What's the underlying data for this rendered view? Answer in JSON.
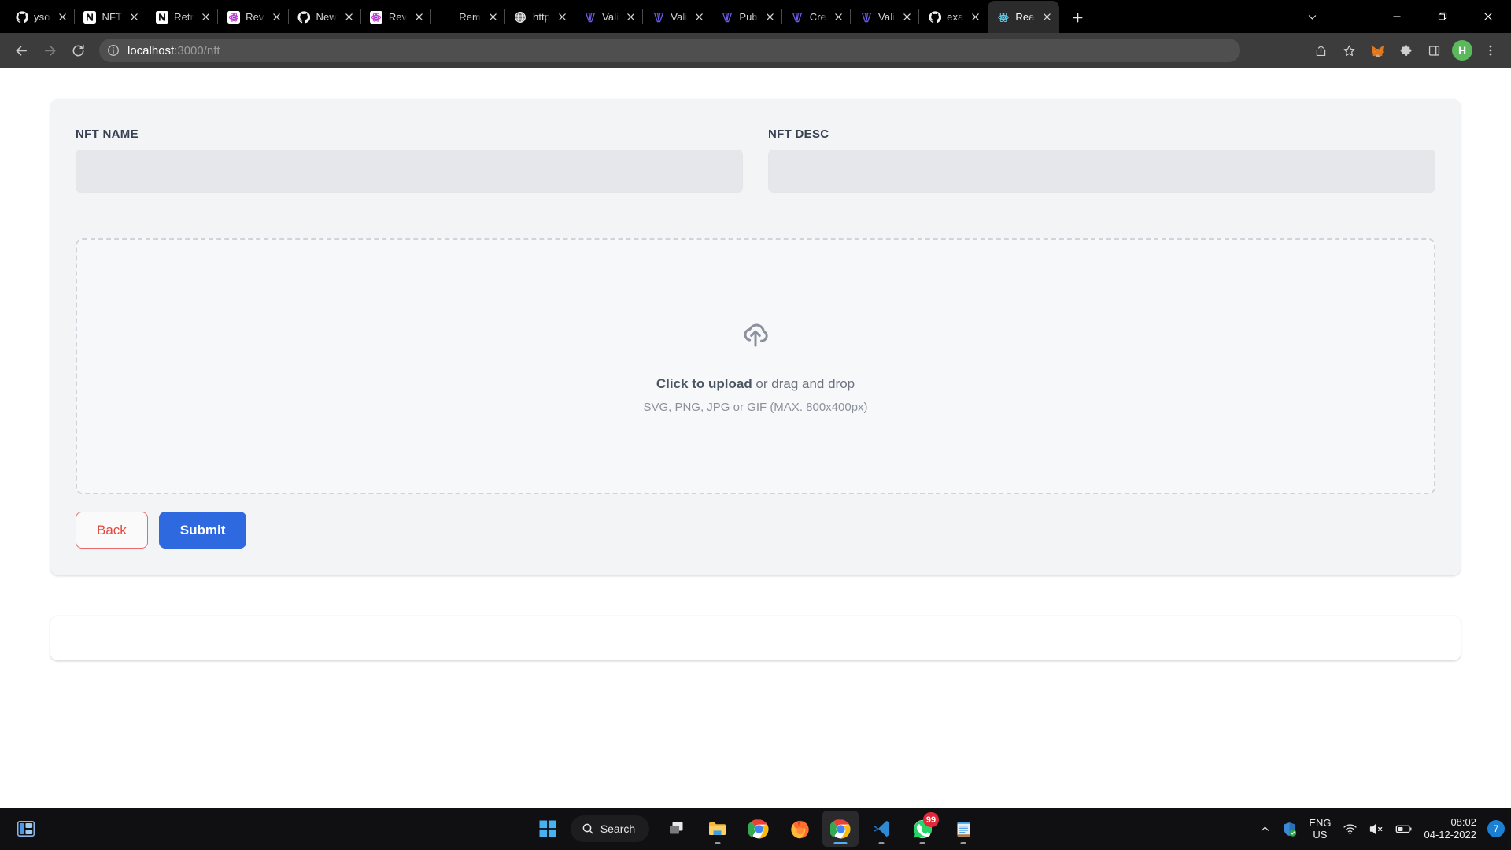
{
  "browser": {
    "tabs": [
      {
        "title": "yso",
        "icon": "github-icon"
      },
      {
        "title": "NFT",
        "icon": "notion-icon"
      },
      {
        "title": "Retr",
        "icon": "notion-icon"
      },
      {
        "title": "Rev",
        "icon": "rev-icon"
      },
      {
        "title": "New",
        "icon": "github-icon"
      },
      {
        "title": "Rev",
        "icon": "rev-icon"
      },
      {
        "title": "Rem",
        "icon": "blank-icon"
      },
      {
        "title": "http",
        "icon": "globe-icon"
      },
      {
        "title": "Vali",
        "icon": "vercel-icon"
      },
      {
        "title": "Vali",
        "icon": "vercel-icon"
      },
      {
        "title": "Pub",
        "icon": "vercel-icon"
      },
      {
        "title": "Cre",
        "icon": "vercel-icon"
      },
      {
        "title": "Vali",
        "icon": "vercel-icon"
      },
      {
        "title": "exa",
        "icon": "github-icon"
      },
      {
        "title": "Rea",
        "icon": "react-icon",
        "active": true
      }
    ],
    "new_tab_label": "+",
    "window_controls": {
      "tab_search": "tab-search",
      "minimize": "minimize",
      "restore": "restore",
      "close": "close"
    },
    "toolbar": {
      "back": "back",
      "forward": "forward",
      "reload": "reload",
      "url_host": "localhost",
      "url_path": ":3000/nft",
      "site_info": "site-information",
      "share": "share",
      "bookmark": "bookmark",
      "metamask": "metamask",
      "extensions": "extensions",
      "side_panel": "side-panel",
      "profile_initial": "H",
      "menu": "chrome-menu"
    }
  },
  "page": {
    "form": {
      "name_field": {
        "label": "NFT NAME",
        "value": "",
        "placeholder": ""
      },
      "desc_field": {
        "label": "NFT DESC",
        "value": "",
        "placeholder": ""
      },
      "dropzone": {
        "primary_bold": "Click to upload",
        "primary_rest": " or drag and drop",
        "secondary": "SVG, PNG, JPG or GIF (MAX. 800x400px)",
        "icon": "cloud-upload-icon"
      },
      "buttons": {
        "back": "Back",
        "submit": "Submit"
      }
    }
  },
  "taskbar": {
    "start": "start-icon",
    "search_label": "Search",
    "items": [
      {
        "name": "task-view",
        "icon": "task-view-icon"
      },
      {
        "name": "file-explorer",
        "icon": "file-explorer-icon",
        "running": true
      },
      {
        "name": "google-chrome",
        "icon": "chrome-icon"
      },
      {
        "name": "mozilla-firefox",
        "icon": "firefox-icon"
      },
      {
        "name": "google-chrome-active",
        "icon": "chrome-icon",
        "active": true
      },
      {
        "name": "visual-studio-code",
        "icon": "vscode-icon",
        "running": true
      },
      {
        "name": "whatsapp",
        "icon": "whatsapp-icon",
        "running": true,
        "badge": "99"
      },
      {
        "name": "notepad",
        "icon": "notepad-icon",
        "running": true
      }
    ],
    "tray": {
      "overflow": "show-hidden-icons",
      "security": "windows-security-icon",
      "language_line1": "ENG",
      "language_line2": "US",
      "wifi": "wifi-icon",
      "volume": "volume-muted-icon",
      "battery": "battery-icon",
      "time": "08:02",
      "date": "04-12-2022",
      "notification_count": "7"
    }
  },
  "colors": {
    "accent_blue": "#2f69e0",
    "danger_red": "#e4483c",
    "card_bg": "#f3f4f6",
    "input_bg": "#e5e7eb"
  }
}
